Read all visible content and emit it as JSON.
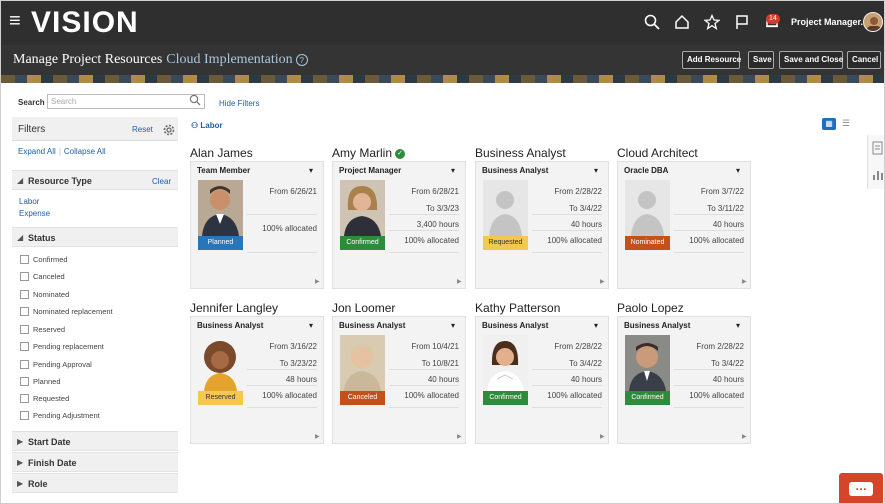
{
  "app": {
    "logo": "VISION",
    "user": "Project Manager...",
    "notifications": "14"
  },
  "header": {
    "title": "Manage Project Resources",
    "subtitle": "Cloud Implementation",
    "buttons": {
      "add": "Add Resource",
      "save": "Save",
      "save_close": "Save and Close",
      "cancel": "Cancel"
    }
  },
  "search": {
    "label": "Search",
    "placeholder": "Search",
    "hide_filters": "Hide Filters"
  },
  "filters": {
    "title": "Filters",
    "reset": "Reset",
    "expand_all": "Expand All",
    "collapse_all": "Collapse All",
    "resource_type": {
      "title": "Resource Type",
      "clear": "Clear",
      "options": [
        "Labor",
        "Expense"
      ]
    },
    "status": {
      "title": "Status",
      "options": [
        "Confirmed",
        "Canceled",
        "Nominated",
        "Nominated replacement",
        "Reserved",
        "Pending replacement",
        "Pending Approval",
        "Planned",
        "Requested",
        "Pending Adjustment"
      ]
    },
    "start_date": "Start Date",
    "finish_date": "Finish Date",
    "role": "Role"
  },
  "chip": "Labor",
  "colors": {
    "planned": "#2875b8",
    "confirmed": "#2e8b3c",
    "requested": "#f2c94c",
    "nominated": "#c4501b",
    "reserved": "#f2c94c",
    "canceled": "#c4501b"
  },
  "cards": [
    {
      "name": "Alan James",
      "role": "Team Member",
      "status": "Planned",
      "from": "From 6/26/21",
      "to": "",
      "hours": "",
      "alloc": "100% allocated"
    },
    {
      "name": "Amy Marlin",
      "role": "Project Manager",
      "status": "Confirmed",
      "from": "From 6/28/21",
      "to": "To 3/3/23",
      "hours": "3,400 hours",
      "alloc": "100% allocated"
    },
    {
      "name": "Business Analyst",
      "role": "Business Analyst",
      "status": "Requested",
      "from": "From 2/28/22",
      "to": "To 3/4/22",
      "hours": "40 hours",
      "alloc": "100% allocated"
    },
    {
      "name": "Cloud Architect",
      "role": "Oracle DBA",
      "status": "Nominated",
      "from": "From 3/7/22",
      "to": "To 3/11/22",
      "hours": "40 hours",
      "alloc": "100% allocated"
    },
    {
      "name": "Jennifer Langley",
      "role": "Business Analyst",
      "status": "Reserved",
      "from": "From 3/16/22",
      "to": "To 3/23/22",
      "hours": "48 hours",
      "alloc": "100% allocated"
    },
    {
      "name": "Jon Loomer",
      "role": "Business Analyst",
      "status": "Canceled",
      "from": "From 10/4/21",
      "to": "To 10/8/21",
      "hours": "40 hours",
      "alloc": "100% allocated"
    },
    {
      "name": "Kathy Patterson",
      "role": "Business Analyst",
      "status": "Confirmed",
      "from": "From 2/28/22",
      "to": "To 3/4/22",
      "hours": "40 hours",
      "alloc": "100% allocated"
    },
    {
      "name": "Paolo Lopez",
      "role": "Business Analyst",
      "status": "Confirmed",
      "from": "From 2/28/22",
      "to": "To 3/4/22",
      "hours": "40 hours",
      "alloc": "100% allocated"
    }
  ]
}
